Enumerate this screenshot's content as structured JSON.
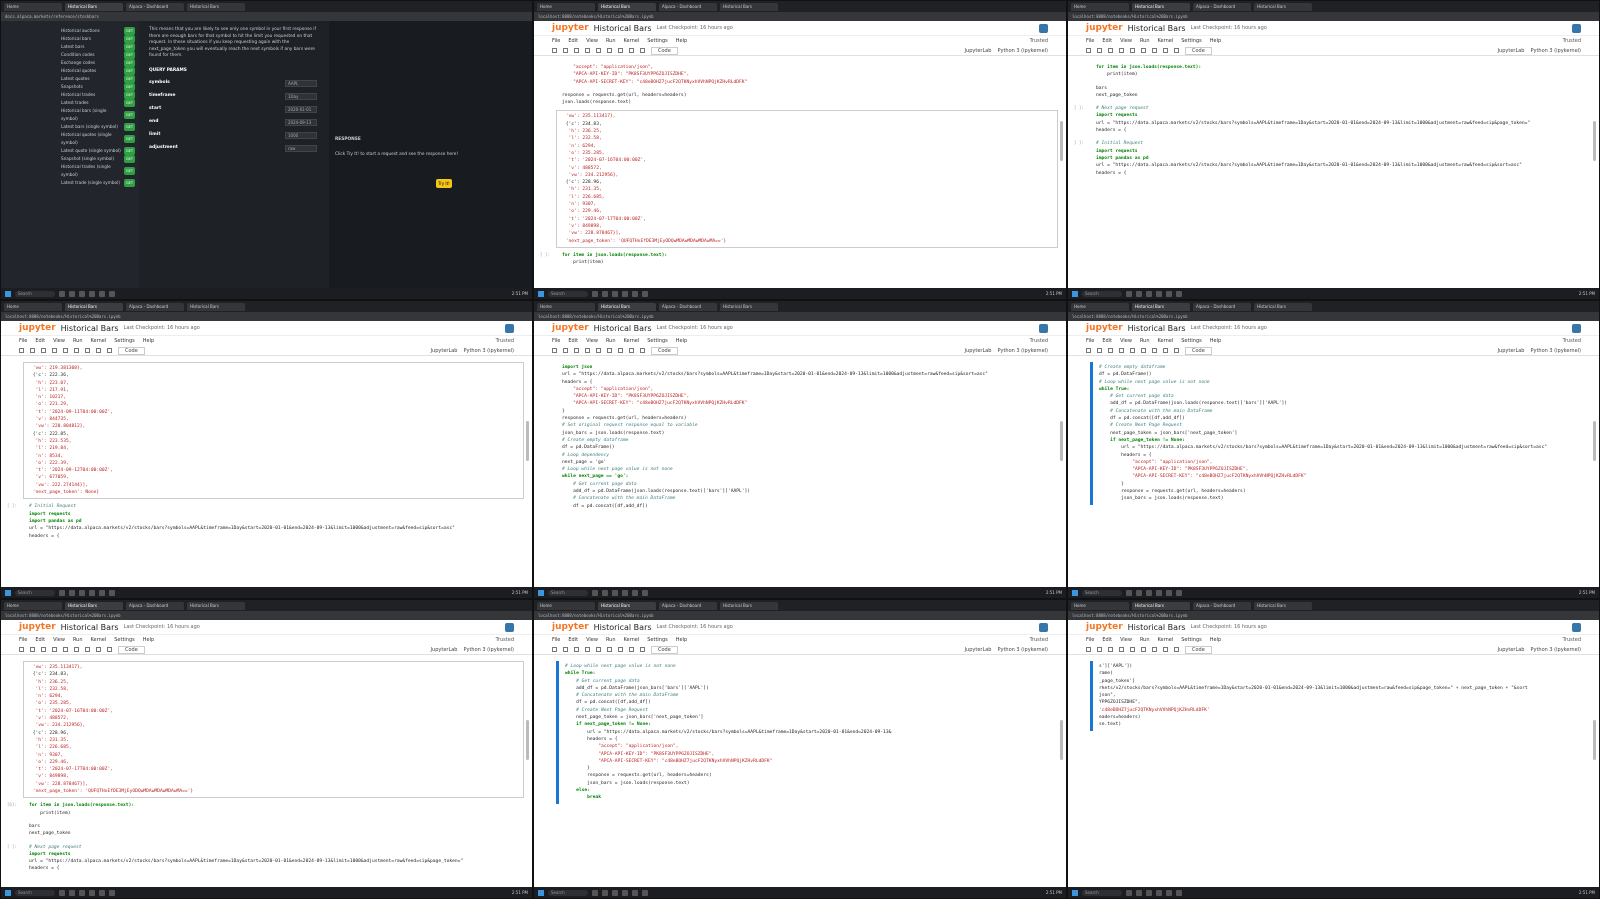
{
  "browser": {
    "tabs": [
      "Home",
      "Historical Bars",
      "Alpaca - Dashboard",
      "Historical Bars"
    ],
    "url_notebook": "localhost:8888/notebooks/Historical%20Bars.ipynb",
    "url_docs": "docs.alpaca.markets/reference/stockbars"
  },
  "jupyter": {
    "logo": "jupyter",
    "title": "Historical Bars",
    "checkpoint": "Last Checkpoint: 16 hours ago",
    "menu": [
      "File",
      "Edit",
      "View",
      "Run",
      "Kernel",
      "Settings",
      "Help"
    ],
    "trusted": "Trusted",
    "cell_type": "Code",
    "jupyterlab": "JupyterLab",
    "kernel": "Python 3 (ipykernel)"
  },
  "taskbar": {
    "search": "Search",
    "time": "2:51 PM"
  },
  "docs": {
    "sidebar": [
      {
        "label": "Historical auctions",
        "badge": "GET"
      },
      {
        "label": "Historical bars",
        "badge": "GET"
      },
      {
        "label": "Latest bars",
        "badge": "GET"
      },
      {
        "label": "Condition codes",
        "badge": "GET"
      },
      {
        "label": "Exchange codes",
        "badge": "GET"
      },
      {
        "label": "Historical quotes",
        "badge": "GET"
      },
      {
        "label": "Latest quotes",
        "badge": "GET"
      },
      {
        "label": "Snapshots",
        "badge": "GET"
      },
      {
        "label": "Historical trades",
        "badge": "GET"
      },
      {
        "label": "Latest trades",
        "badge": "GET"
      },
      {
        "label": "Historical bars (single symbol)",
        "badge": "GET"
      },
      {
        "label": "Latest bars (single symbol)",
        "badge": "GET"
      },
      {
        "label": "Historical quotes (single symbol)",
        "badge": "GET"
      },
      {
        "label": "Latest quote (single symbol)",
        "badge": "GET"
      },
      {
        "label": "Snapshot (single symbol)",
        "badge": "GET"
      },
      {
        "label": "Historical trades (single symbol)",
        "badge": "GET"
      },
      {
        "label": "Latest trade (single symbol)",
        "badge": "GET"
      }
    ],
    "intro": "This means that you are likely to see only one symbol in your first response if there are enough bars for that symbol to hit the limit you requested on that request. In these situations if you keep requesting again with the next_page_token you will eventually reach the next symbols if any bars were found for them.",
    "section": "QUERY PARAMS",
    "params": [
      {
        "name": "symbols",
        "value": "AAPL"
      },
      {
        "name": "timeframe",
        "value": "1Day"
      },
      {
        "name": "start",
        "value": "2020-01-01"
      },
      {
        "name": "end",
        "value": "2024-09-13"
      },
      {
        "name": "limit",
        "value": "1000"
      },
      {
        "name": "adjustment",
        "value": "raw"
      }
    ],
    "try_label": "Try It!",
    "response_label": "RESPONSE",
    "response_hint": "Click Try It! to start a request and see the response here!"
  },
  "cells": {
    "headers_tail": [
      "    \"accept\": \"application/json\",",
      "    \"APCA-API-KEY-ID\": \"PK8SF3UYPP6ZOJISZDHE\",",
      "    \"APCA-API-SECRET-KEY\": \"c48eBOHZ7jucF2QTKNyxhVVhNPQjKZHvRLdDFK\""
    ],
    "request": [
      "response = requests.get(url, headers=headers)",
      "json.loads(response.text)"
    ],
    "output_a": [
      " 'vw': 235.113417},",
      " {'c': 234.83,",
      "  'h': 236.25,",
      "  'l': 232.58,",
      "  'n': 6294,",
      "  'o': 235.285,",
      "  't': '2024-07-16T04:00:00Z',",
      "  'v': 488572,",
      "  'vw': 234.212956},",
      " {'c': 228.96,",
      "  'h': 231.35,",
      "  'l': 226.685,",
      "  'n': 9307,",
      "  'o': 229.46,",
      "  't': '2024-07-17T04:00:00Z',",
      "  'v': 849898,",
      "  'vw': 228.878467}],",
      " 'next_page_token': 'QUFQTHxEfDE3MjEyODQwMDAwMDAwMDAwMA=='}"
    ],
    "output_b": [
      " 'vw': 219.381308},",
      " {'c': 222.36,",
      "  'h': 223.07,",
      "  'l': 217.91,",
      "  'n': 10217,",
      "  'o': 221.29,",
      "  't': '2024-09-11T04:00:00Z',",
      "  'v': 844735,",
      "  'vw': 220.804812},",
      " {'c': 222.85,",
      "  'h': 223.535,",
      "  'l': 219.84,",
      "  'n': 8534,",
      "  'o': 222.39,",
      "  't': '2024-09-12T04:00:00Z',",
      "  'v': 677059,",
      "  'vw': 222.274144}],",
      " 'next_page_token': None}"
    ],
    "for_loop": [
      "for item in json.loads(response.text):",
      "",
      "    print(item)"
    ],
    "print_out": [
      "bars",
      "next_page_token"
    ],
    "next_page": [
      "# Next page request",
      "import requests",
      "",
      "url = \"https://data.alpaca.markets/v2/stocks/bars?symbols=AAPL&timeframe=1Day&start=2020-01-01&end=2024-09-13&limit=1000&adjustment=raw&feed=sip&page_token=\"",
      "",
      "headers = {"
    ],
    "initial": [
      "# Initial Request",
      "import requests",
      "import pandas as pd",
      "",
      "url = \"https://data.alpaca.markets/v2/stocks/bars?symbols=AAPL&timeframe=1Day&start=2020-01-01&end=2024-09-13&limit=1000&adjustment=raw&feed=sip&sort=asc\"",
      "",
      "headers = {"
    ],
    "loop_setup": [
      "import json",
      "",
      "url = \"https://data.alpaca.markets/v2/stocks/bars?symbols=AAPL&timeframe=1Day&start=2020-01-01&end=2024-09-13&limit=1000&adjustment=raw&feed=sip&sort=asc\"",
      "",
      "headers = {",
      "    \"accept\": \"application/json\",",
      "    \"APCA-API-KEY-ID\": \"PK8SF3UYPP6ZOJISZDHE\",",
      "    \"APCA-API-SECRET-KEY\": \"c48eBOHZ7jucF2QTKNyxhVVhNPQjKZHvRLdDFK\"",
      "}",
      "",
      "response = requests.get(url, headers=headers)",
      "",
      "# Set original request response equal to variable",
      "json_bars = json.loads(response.text)",
      "",
      "# Create empty dataframe",
      "df = pd.DataFrame()",
      "",
      "# Loop dependency",
      "next_page = 'go'",
      "",
      "# Loop while next page value is not none",
      "while next_page == 'go':",
      "",
      "    # Get current page data",
      "    add_df = pd.DataFrame(json.loads(response.text)['bars']['AAPL'])",
      "",
      "    # Concatenate with the main DataFrame",
      "    df = pd.concat([df,add_df])"
    ],
    "loop_true": [
      "# Create empty dataframe",
      "df = pd.DataFrame()",
      "",
      "# Loop while next page value is not none",
      "while True:",
      "",
      "    # Get current page data",
      "    add_df = pd.DataFrame(json.loads(response.text)['bars']['AAPL'])",
      "",
      "    # Concatenate with the main DataFrame",
      "    df = pd.concat([df,add_df])",
      "",
      "    # Create Next Page Request",
      "    next_page_token = json_bars['next_page_token']",
      "",
      "    if next_page_token != None:",
      "",
      "        url = \"https://data.alpaca.markets/v2/stocks/bars?symbols=AAPL&timeframe=1Day&start=2020-01-01&end=2024-09-13&limit=1000&adjustment=raw&feed=sip&sort=asc\"",
      "",
      "        headers = {",
      "            \"accept\": \"application/json\",",
      "            \"APCA-API-KEY-ID\": \"PK8SF3UYPP6ZOJISZDHE\",",
      "            \"APCA-API-SECRET-KEY\": \"c48eBOHZ7jucF2QTKNyxhVVhNPQjKZHvRLdDFK\"",
      "        }",
      "",
      "        response = requests.get(url, headers=headers)",
      "",
      "        json_bars = json.loads(response.text)"
    ],
    "loop_break": [
      "# Loop while next page value is not none",
      "while True:",
      "",
      "    # Get current page data",
      "    add_df = pd.DataFrame(json_bars['bars']['AAPL'])",
      "",
      "    # Concatenate with the main DataFrame",
      "    df = pd.concat([df,add_df])",
      "",
      "    # Create Next Page Request",
      "    next_page_token = json_bars['next_page_token']",
      "",
      "    if next_page_token != None:",
      "",
      "        url = \"https://data.alpaca.markets/v2/stocks/bars?symbols=AAPL&timeframe=1Day&start=2020-01-01&end=2024-09-13&",
      "",
      "        headers = {",
      "            \"accept\": \"application/json\",",
      "            \"APCA-API-KEY-ID\": \"PK8SF3UYPP6ZOJISZDHE\",",
      "            \"APCA-API-SECRET-KEY\": \"c48eBOHZ7jucF2QTKNyxhVVhNPQjKZHvRLdDFK\"",
      "        }",
      "",
      "        response = requests.get(url, headers=headers)",
      "",
      "        json_bars = json.loads(response.text)",
      "",
      "    else:",
      "        break"
    ],
    "scrolled": [
      "s']['AAPL'])",
      "",
      "rame)",
      "",
      "",
      "_page_token']",
      "",
      "",
      "",
      "rkets/v2/stocks/bars?symbols=AAPL&timeframe=1Day&start=2020-01-01&end=2024-09-13&limit=1000&adjustment=raw&feed=sip&page_token=\" + next_page_token + \"&sort",
      "",
      "json\",",
      "YPP6ZOJISZDHE\",",
      "'c48eBOHZ7jucF2QTKNyxhVVhNPQjKZHvRLdDFK'",
      "",
      "",
      "eaders=headers)",
      "",
      "se.text)"
    ]
  }
}
